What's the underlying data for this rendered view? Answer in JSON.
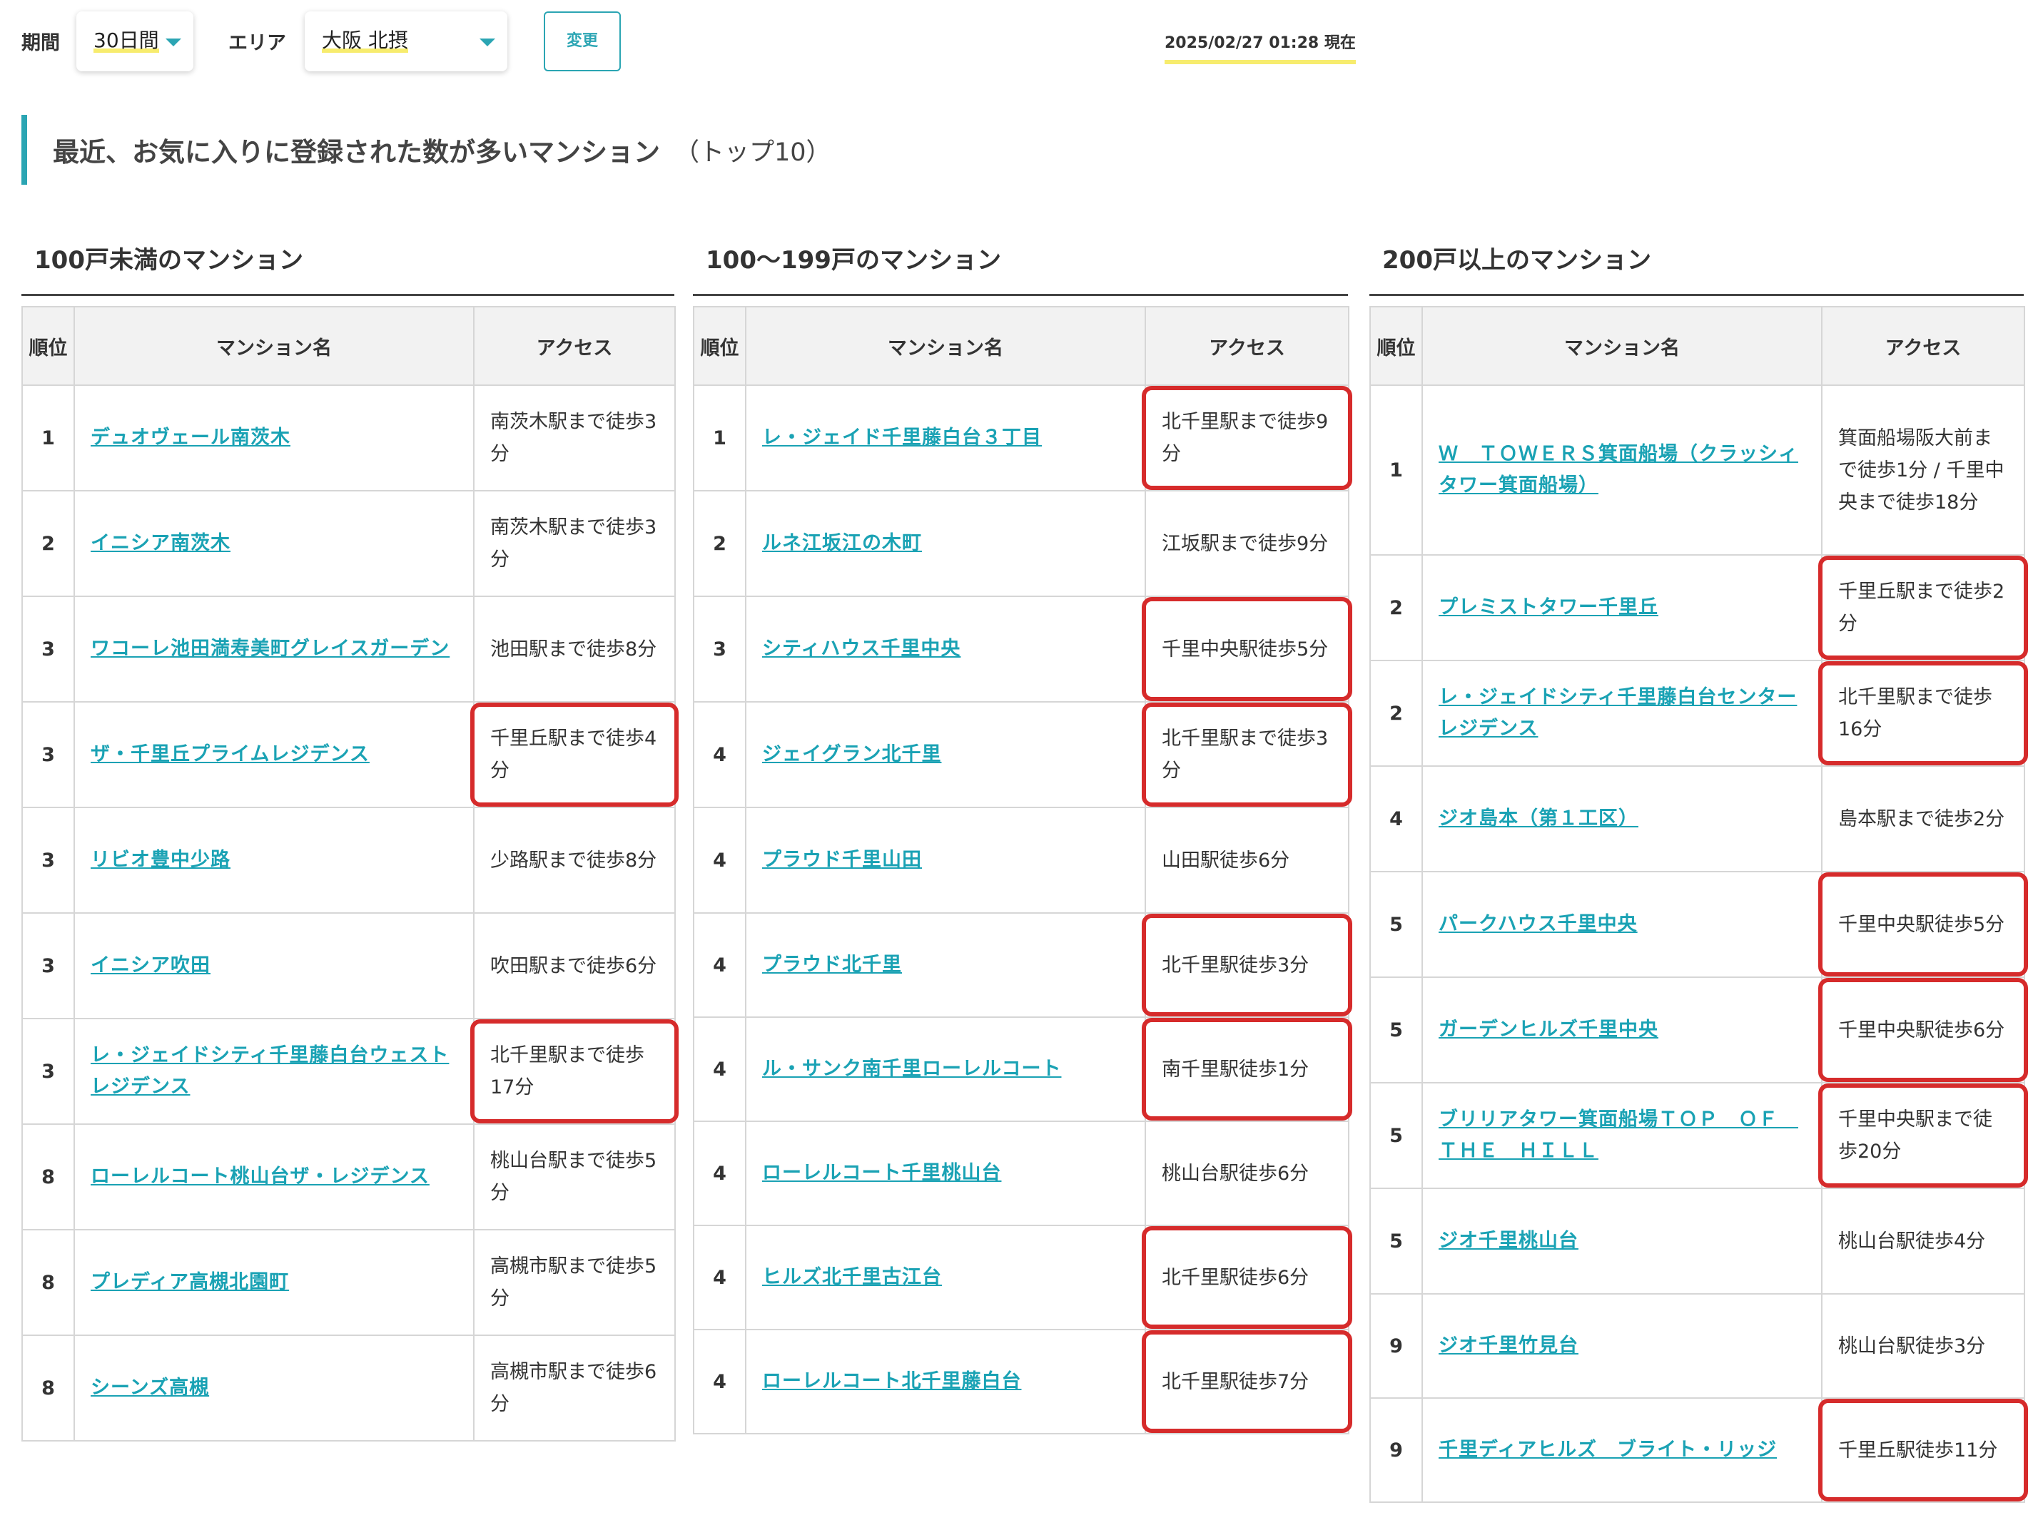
{
  "filters": {
    "period_label": "期間",
    "period_value": "30日間",
    "area_label": "エリア",
    "area_value": "大阪 北摂",
    "change_button": "変更",
    "timestamp": "2025/02/27 01:28 現在"
  },
  "heading": {
    "title": "最近、お気に入りに登録された数が多いマンション",
    "suffix": "（トップ10）"
  },
  "table_headers": {
    "rank": "順位",
    "name": "マンション名",
    "access": "アクセス"
  },
  "colors": {
    "accent": "#2ba5b3",
    "link": "#1aa2b4",
    "highlight_box": "#d62b2b",
    "marker": "#f7ec6e"
  },
  "columns": [
    {
      "title": "100戸未満のマンション",
      "rows": [
        {
          "rank": "1",
          "name": "デュオヴェール南茨木",
          "access": "南茨木駅まで徒歩3分",
          "highlighted": false
        },
        {
          "rank": "2",
          "name": "イニシア南茨木",
          "access": "南茨木駅まで徒歩3分",
          "highlighted": false
        },
        {
          "rank": "3",
          "name": "ワコーレ池田満寿美町グレイスガーデン",
          "access": "池田駅まで徒歩8分",
          "highlighted": false
        },
        {
          "rank": "3",
          "name": "ザ・千里丘プライムレジデンス",
          "access": "千里丘駅まで徒歩4分",
          "highlighted": true
        },
        {
          "rank": "3",
          "name": "リビオ豊中少路",
          "access": "少路駅まで徒歩8分",
          "highlighted": false
        },
        {
          "rank": "3",
          "name": "イニシア吹田",
          "access": "吹田駅まで徒歩6分",
          "highlighted": false
        },
        {
          "rank": "3",
          "name": "レ・ジェイドシティ千里藤白台ウェストレジデンス",
          "access": "北千里駅まで徒歩17分",
          "highlighted": true
        },
        {
          "rank": "8",
          "name": "ローレルコート桃山台ザ・レジデンス",
          "access": "桃山台駅まで徒歩5分",
          "highlighted": false
        },
        {
          "rank": "8",
          "name": "プレディア高槻北園町",
          "access": "高槻市駅まで徒歩5分",
          "highlighted": false
        },
        {
          "rank": "8",
          "name": "シーンズ高槻",
          "access": "高槻市駅まで徒歩6分",
          "highlighted": false
        }
      ]
    },
    {
      "title": "100〜199戸のマンション",
      "rows": [
        {
          "rank": "1",
          "name": "レ・ジェイド千里藤白台３丁目",
          "access": "北千里駅まで徒歩9分",
          "highlighted": true
        },
        {
          "rank": "2",
          "name": "ルネ江坂江の木町",
          "access": "江坂駅まで徒歩9分",
          "highlighted": false
        },
        {
          "rank": "3",
          "name": "シティハウス千里中央",
          "access": "千里中央駅徒歩5分",
          "highlighted": true
        },
        {
          "rank": "4",
          "name": "ジェイグラン北千里",
          "access": "北千里駅まで徒歩3分",
          "highlighted": true
        },
        {
          "rank": "4",
          "name": "プラウド千里山田",
          "access": "山田駅徒歩6分",
          "highlighted": false
        },
        {
          "rank": "4",
          "name": "プラウド北千里",
          "access": "北千里駅徒歩3分",
          "highlighted": true
        },
        {
          "rank": "4",
          "name": "ル・サンク南千里ローレルコート",
          "access": "南千里駅徒歩1分",
          "highlighted": true
        },
        {
          "rank": "4",
          "name": "ローレルコート千里桃山台",
          "access": "桃山台駅徒歩6分",
          "highlighted": false
        },
        {
          "rank": "4",
          "name": "ヒルズ北千里古江台",
          "access": "北千里駅徒歩6分",
          "highlighted": true
        },
        {
          "rank": "4",
          "name": "ローレルコート北千里藤白台",
          "access": "北千里駅徒歩7分",
          "highlighted": true
        }
      ]
    },
    {
      "title": "200戸以上のマンション",
      "rows": [
        {
          "rank": "1",
          "name": "Ｗ　ＴＯＷＥＲＳ箕面船場（クラッシィタワー箕面船場）",
          "access": "箕面船場阪大前まで徒歩1分 / 千里中央まで徒歩18分",
          "highlighted": false
        },
        {
          "rank": "2",
          "name": "プレミストタワー千里丘",
          "access": "千里丘駅まで徒歩2分",
          "highlighted": true
        },
        {
          "rank": "2",
          "name": "レ・ジェイドシティ千里藤白台センターレジデンス",
          "access": "北千里駅まで徒歩16分",
          "highlighted": true
        },
        {
          "rank": "4",
          "name": "ジオ島本（第１工区）",
          "access": "島本駅まで徒歩2分",
          "highlighted": false
        },
        {
          "rank": "5",
          "name": "パークハウス千里中央",
          "access": "千里中央駅徒歩5分",
          "highlighted": true
        },
        {
          "rank": "5",
          "name": "ガーデンヒルズ千里中央",
          "access": "千里中央駅徒歩6分",
          "highlighted": true
        },
        {
          "rank": "5",
          "name": "ブリリアタワー箕面船場ＴＯＰ　ＯＦ　ＴＨＥ　ＨＩＬＬ",
          "access": "千里中央駅まで徒歩20分",
          "highlighted": true
        },
        {
          "rank": "5",
          "name": "ジオ千里桃山台",
          "access": "桃山台駅徒歩4分",
          "highlighted": false
        },
        {
          "rank": "9",
          "name": "ジオ千里竹見台",
          "access": "桃山台駅徒歩3分",
          "highlighted": false
        },
        {
          "rank": "9",
          "name": "千里ディアヒルズ　ブライト・リッジ",
          "access": "千里丘駅徒歩11分",
          "highlighted": true
        }
      ]
    }
  ]
}
